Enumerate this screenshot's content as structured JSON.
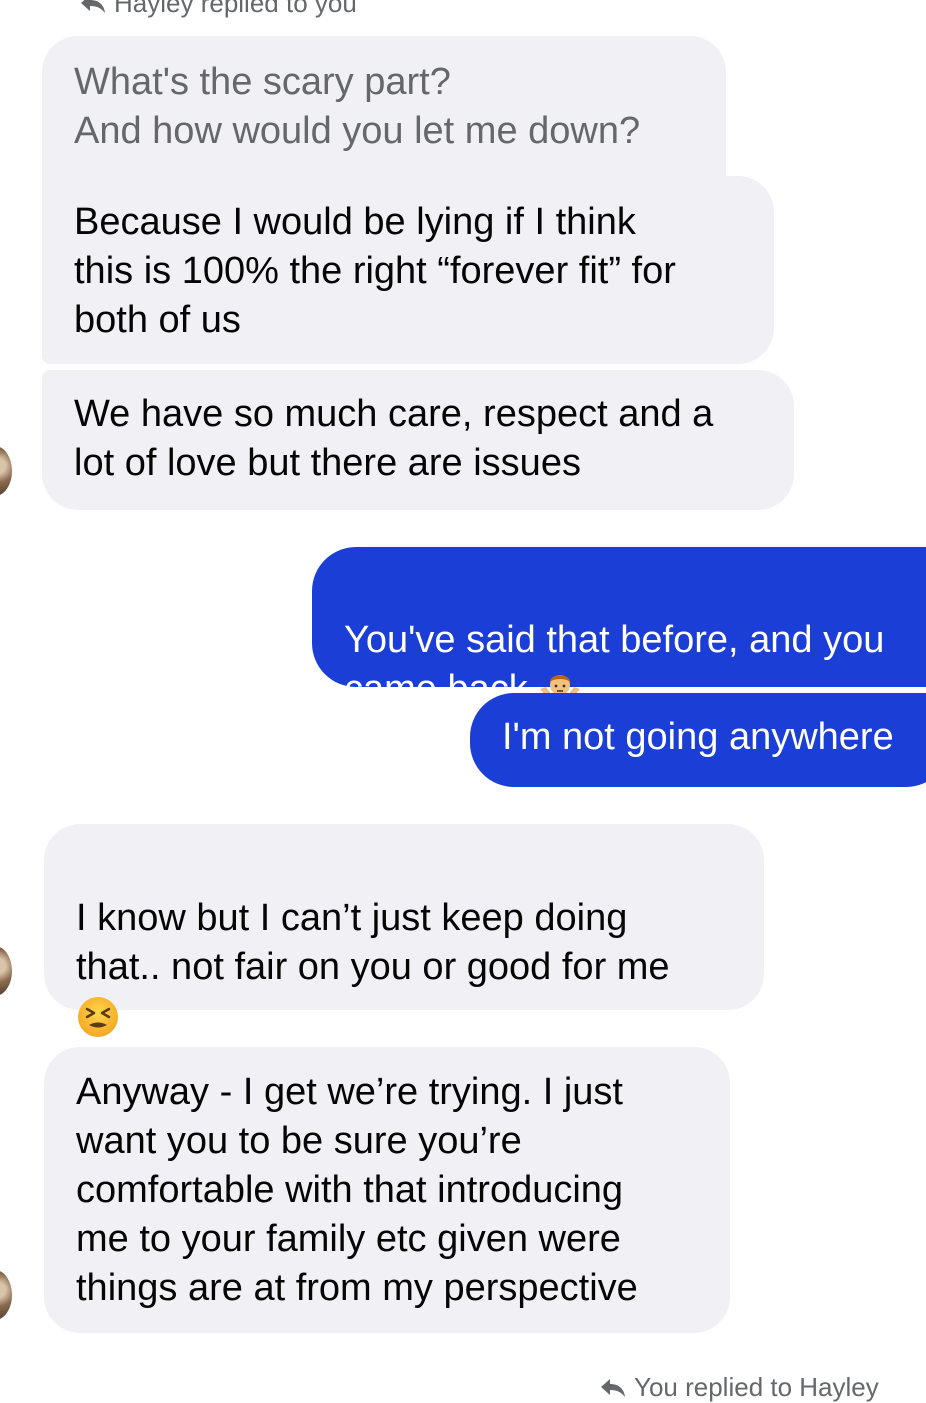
{
  "thread": {
    "reply_hint_top": "Hayley replied to you",
    "reply_hint_bottom": "You replied to Hayley",
    "quoted_message": "What's the scary part?\nAnd how would you let me down?",
    "messages": [
      {
        "sender": "Hayley",
        "text": "Because I would be lying if I think\nthis is 100% the right “forever fit” for\nboth of us"
      },
      {
        "sender": "Hayley",
        "text": "We have so much care, respect and a\nlot of love but there are issues"
      },
      {
        "sender": "You",
        "text": "You've said that before, and you\ncame back",
        "emoji": "person-shrugging-emoji"
      },
      {
        "sender": "You",
        "text": "I'm not going anywhere"
      },
      {
        "sender": "Hayley",
        "text": "I know but I can’t just keep doing\nthat.. not fair on you or good for me",
        "emoji": "tired-face-emoji"
      },
      {
        "sender": "Hayley",
        "text": "Anyway - I get we’re trying. I just\nwant you to be sure you’re\ncomfortable with that introducing\nme to your family etc given were\nthings are at from my perspective"
      }
    ]
  },
  "colors": {
    "incoming_bubble": "#f0f0f5",
    "outgoing_bubble": "#1a3ed6",
    "secondary_text": "#65676b"
  }
}
